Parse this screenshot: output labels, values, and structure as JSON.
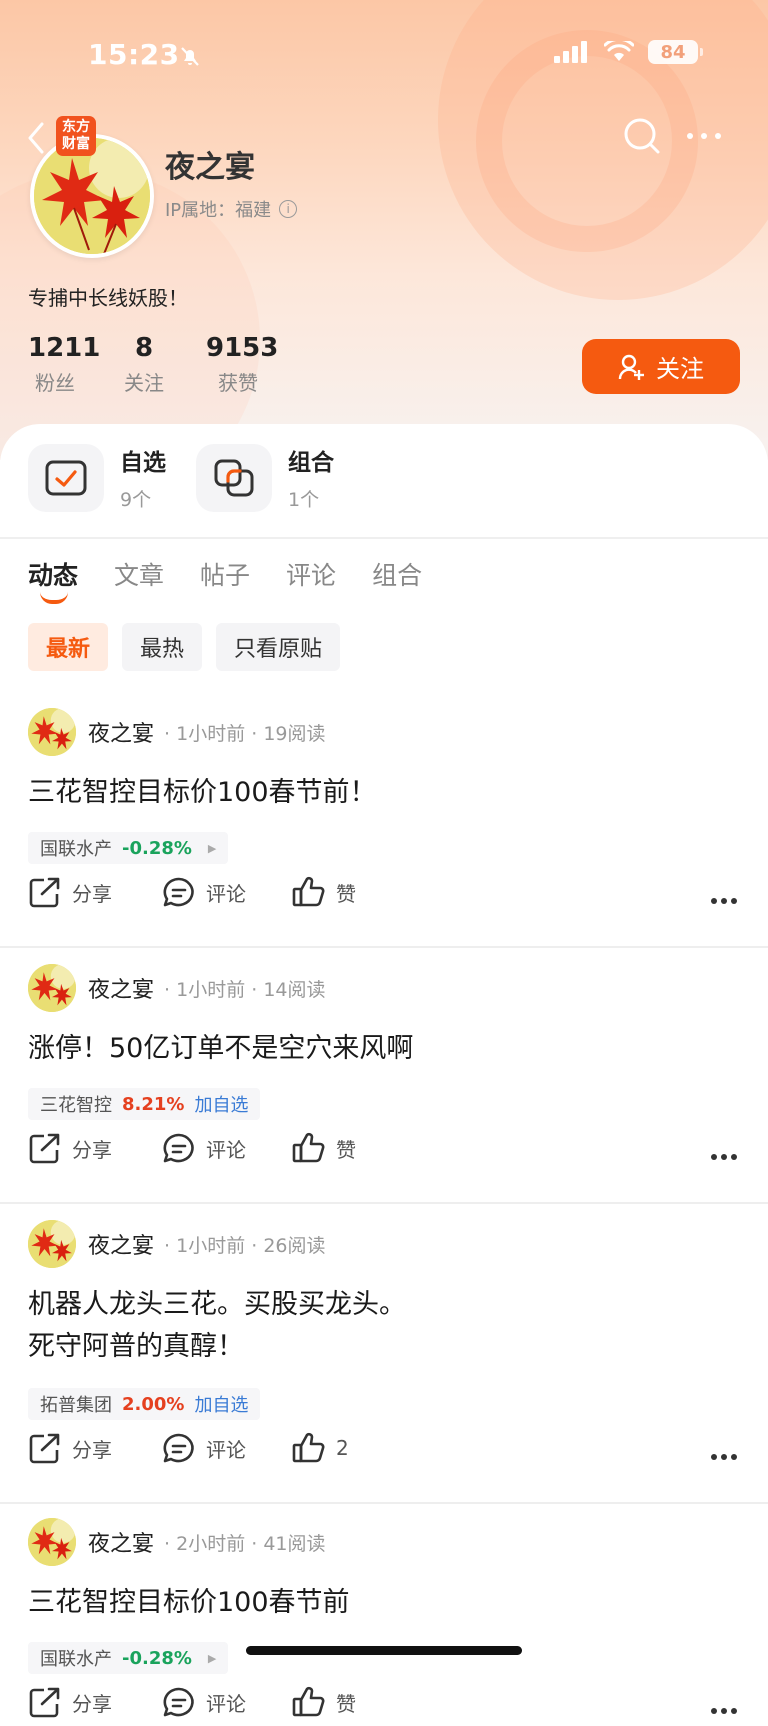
{
  "status_bar": {
    "time": "15:23",
    "battery": "84"
  },
  "profile": {
    "brand_badge_line1": "东方",
    "brand_badge_line2": "财富",
    "name": "夜之宴",
    "ip_label": "IP属地：",
    "ip_location": "福建",
    "bio": "专捕中长线妖股！",
    "stats": [
      {
        "value": "1211",
        "label": "粉丝"
      },
      {
        "value": "8",
        "label": "关注"
      },
      {
        "value": "9153",
        "label": "获赞"
      }
    ],
    "follow_label": "关注"
  },
  "quick_links": [
    {
      "title": "自选",
      "count": "9个",
      "icon": "checklist-icon"
    },
    {
      "title": "组合",
      "count": "1个",
      "icon": "portfolio-icon"
    }
  ],
  "tabs": [
    "动态",
    "文章",
    "帖子",
    "评论",
    "组合"
  ],
  "active_tab": "动态",
  "filters": [
    "最新",
    "最热",
    "只看原贴"
  ],
  "active_filter": "最新",
  "colors": {
    "accent": "#f55a10",
    "down": "#1aa35c",
    "up": "#e5401f",
    "link": "#3a7bd5"
  },
  "posts": [
    {
      "author": "夜之宴",
      "time": "1小时前",
      "reads": "19阅读",
      "lines": [
        "三花智控目标价100春节前！"
      ],
      "stock": {
        "name": "国联水产",
        "change": "-0.28%",
        "direction": "down",
        "add": ""
      },
      "share": "分享",
      "comment": "评论",
      "like": "赞"
    },
    {
      "author": "夜之宴",
      "time": "1小时前",
      "reads": "14阅读",
      "lines": [
        "涨停！50亿订单不是空穴来风啊"
      ],
      "stock": {
        "name": "三花智控",
        "change": "8.21%",
        "direction": "up",
        "add": "加自选"
      },
      "share": "分享",
      "comment": "评论",
      "like": "赞"
    },
    {
      "author": "夜之宴",
      "time": "1小时前",
      "reads": "26阅读",
      "lines": [
        "机器人龙头三花。买股买龙头。",
        "死守阿普的真醇！"
      ],
      "stock": {
        "name": "拓普集团",
        "change": "2.00%",
        "direction": "up",
        "add": "加自选"
      },
      "share": "分享",
      "comment": "评论",
      "like": "2"
    },
    {
      "author": "夜之宴",
      "time": "2小时前",
      "reads": "41阅读",
      "lines": [
        "三花智控目标价100春节前"
      ],
      "stock": {
        "name": "国联水产",
        "change": "-0.28%",
        "direction": "down",
        "add": ""
      },
      "share": "分享",
      "comment": "评论",
      "like": "赞"
    }
  ]
}
